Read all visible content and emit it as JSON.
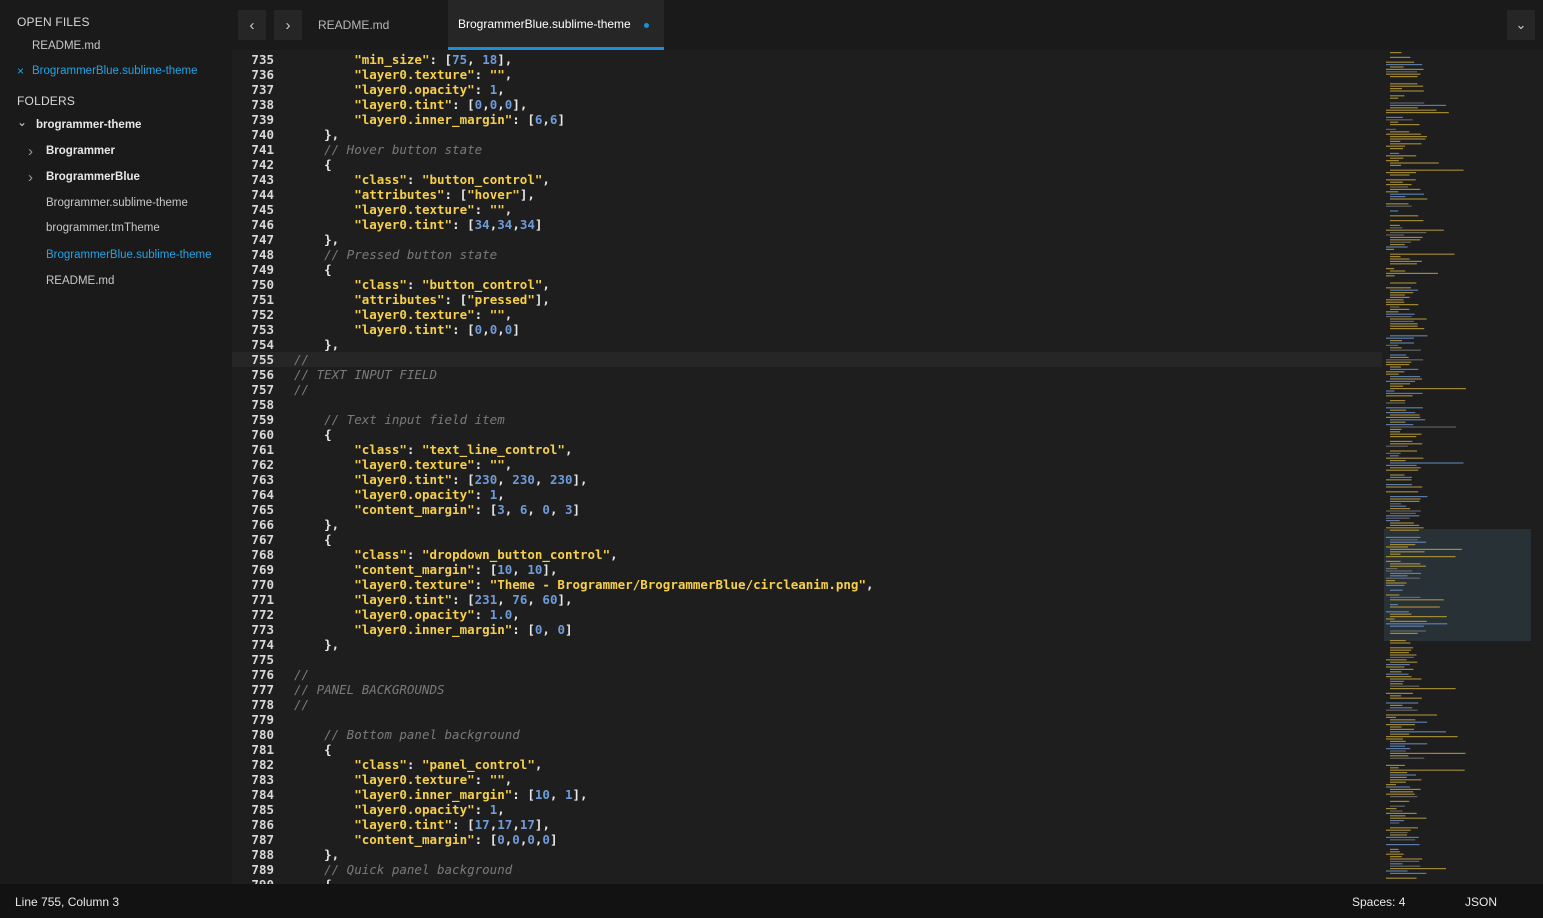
{
  "sidebar": {
    "open_files_header": "OPEN FILES",
    "open_files": [
      {
        "label": "README.md",
        "active": false
      },
      {
        "label": "BrogrammerBlue.sublime-theme",
        "active": true
      }
    ],
    "folders_header": "FOLDERS",
    "root_folder": "brogrammer-theme",
    "folder_items": [
      {
        "label": "Brogrammer",
        "type": "folder"
      },
      {
        "label": "BrogrammerBlue",
        "type": "folder"
      },
      {
        "label": "Brogrammer.sublime-theme",
        "type": "file"
      },
      {
        "label": "brogrammer.tmTheme",
        "type": "file"
      },
      {
        "label": "BrogrammerBlue.sublime-theme",
        "type": "file",
        "active": true
      },
      {
        "label": "README.md",
        "type": "file"
      }
    ],
    "icons": {
      "close": "×",
      "chevron_down": "⌄",
      "chevron_right": "›"
    }
  },
  "tabbar": {
    "back_icon": "‹",
    "forward_icon": "›",
    "tabs": [
      {
        "label": "README.md",
        "active": false
      },
      {
        "label": "BrogrammerBlue.sublime-theme",
        "active": true,
        "dirty": true
      }
    ],
    "dropdown_icon": "⌄"
  },
  "editor": {
    "current_line": 755,
    "lines": [
      {
        "n": "735",
        "code": "        \"min_size\": [75, 18],"
      },
      {
        "n": "736",
        "code": "        \"layer0.texture\": \"\","
      },
      {
        "n": "737",
        "code": "        \"layer0.opacity\": 1,"
      },
      {
        "n": "738",
        "code": "        \"layer0.tint\": [0,0,0],"
      },
      {
        "n": "739",
        "code": "        \"layer0.inner_margin\": [6,6]"
      },
      {
        "n": "740",
        "code": "    },"
      },
      {
        "n": "741",
        "code": "    // Hover button state"
      },
      {
        "n": "742",
        "code": "    {"
      },
      {
        "n": "743",
        "code": "        \"class\": \"button_control\","
      },
      {
        "n": "744",
        "code": "        \"attributes\": [\"hover\"],"
      },
      {
        "n": "745",
        "code": "        \"layer0.texture\": \"\","
      },
      {
        "n": "746",
        "code": "        \"layer0.tint\": [34,34,34]"
      },
      {
        "n": "747",
        "code": "    },"
      },
      {
        "n": "748",
        "code": "    // Pressed button state"
      },
      {
        "n": "749",
        "code": "    {"
      },
      {
        "n": "750",
        "code": "        \"class\": \"button_control\","
      },
      {
        "n": "751",
        "code": "        \"attributes\": [\"pressed\"],"
      },
      {
        "n": "752",
        "code": "        \"layer0.texture\": \"\","
      },
      {
        "n": "753",
        "code": "        \"layer0.tint\": [0,0,0]"
      },
      {
        "n": "754",
        "code": "    },"
      },
      {
        "n": "755",
        "code": "//"
      },
      {
        "n": "756",
        "code": "// TEXT INPUT FIELD"
      },
      {
        "n": "757",
        "code": "//"
      },
      {
        "n": "758",
        "code": ""
      },
      {
        "n": "759",
        "code": "    // Text input field item"
      },
      {
        "n": "760",
        "code": "    {"
      },
      {
        "n": "761",
        "code": "        \"class\": \"text_line_control\","
      },
      {
        "n": "762",
        "code": "        \"layer0.texture\": \"\","
      },
      {
        "n": "763",
        "code": "        \"layer0.tint\": [230, 230, 230],"
      },
      {
        "n": "764",
        "code": "        \"layer0.opacity\": 1,"
      },
      {
        "n": "765",
        "code": "        \"content_margin\": [3, 6, 0, 3]"
      },
      {
        "n": "766",
        "code": "    },"
      },
      {
        "n": "767",
        "code": "    {"
      },
      {
        "n": "768",
        "code": "        \"class\": \"dropdown_button_control\","
      },
      {
        "n": "769",
        "code": "        \"content_margin\": [10, 10],"
      },
      {
        "n": "770",
        "code": "        \"layer0.texture\": \"Theme - Brogrammer/BrogrammerBlue/circleanim.png\","
      },
      {
        "n": "771",
        "code": "        \"layer0.tint\": [231, 76, 60],"
      },
      {
        "n": "772",
        "code": "        \"layer0.opacity\": 1.0,"
      },
      {
        "n": "773",
        "code": "        \"layer0.inner_margin\": [0, 0]"
      },
      {
        "n": "774",
        "code": "    },"
      },
      {
        "n": "775",
        "code": ""
      },
      {
        "n": "776",
        "code": "//"
      },
      {
        "n": "777",
        "code": "// PANEL BACKGROUNDS"
      },
      {
        "n": "778",
        "code": "//"
      },
      {
        "n": "779",
        "code": ""
      },
      {
        "n": "780",
        "code": "    // Bottom panel background"
      },
      {
        "n": "781",
        "code": "    {"
      },
      {
        "n": "782",
        "code": "        \"class\": \"panel_control\","
      },
      {
        "n": "783",
        "code": "        \"layer0.texture\": \"\","
      },
      {
        "n": "784",
        "code": "        \"layer0.inner_margin\": [10, 1],"
      },
      {
        "n": "785",
        "code": "        \"layer0.opacity\": 1,"
      },
      {
        "n": "786",
        "code": "        \"layer0.tint\": [17,17,17],"
      },
      {
        "n": "787",
        "code": "        \"content_margin\": [0,0,0,0]"
      },
      {
        "n": "788",
        "code": "    },"
      },
      {
        "n": "789",
        "code": "    // Quick panel background"
      },
      {
        "n": "790",
        "code": "    {"
      }
    ]
  },
  "statusbar": {
    "position": "Line 755, Column 3",
    "indentation": "Spaces: 4",
    "syntax": "JSON"
  },
  "colors": {
    "accent": "#23a3e6",
    "string": "#f7d04b",
    "number": "#6f9bd8",
    "comment": "#7a7a7a"
  }
}
